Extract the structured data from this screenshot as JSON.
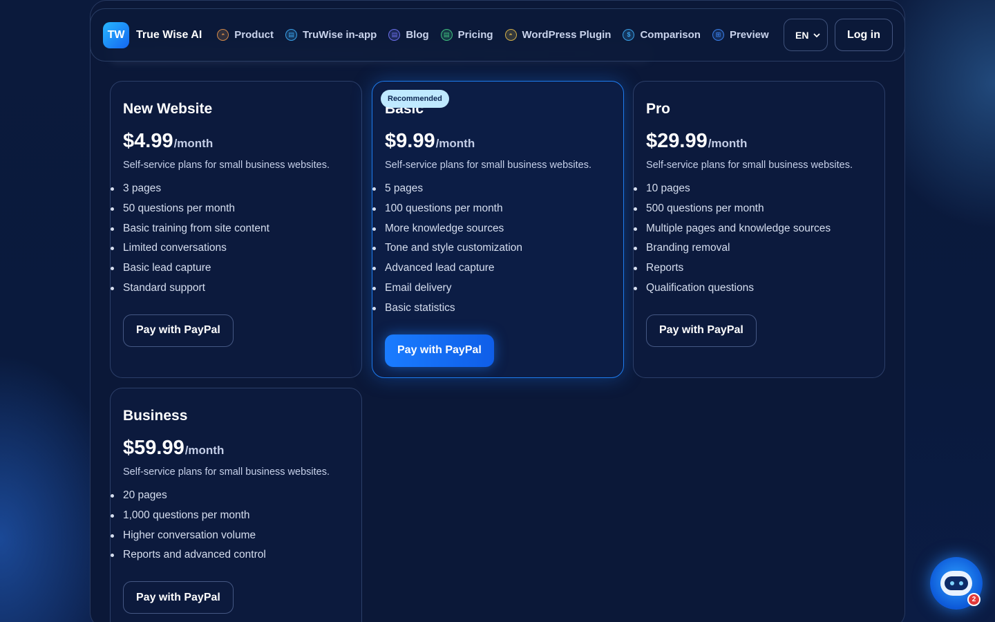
{
  "brand": {
    "logo_text": "TW",
    "name": "True Wise AI"
  },
  "nav": [
    {
      "label": "Product",
      "icon": "robot-icon",
      "color": "#d48a4a",
      "glyph": "◓"
    },
    {
      "label": "TruWise in-app",
      "icon": "chat-icon",
      "color": "#3aa0e8",
      "glyph": "▤"
    },
    {
      "label": "Blog",
      "icon": "document-icon",
      "color": "#6a6ee8",
      "glyph": "▤"
    },
    {
      "label": "Pricing",
      "icon": "card-icon",
      "color": "#3fbf7f",
      "glyph": "▤"
    },
    {
      "label": "WordPress Plugin",
      "icon": "plug-icon",
      "color": "#d4b04a",
      "glyph": "◓"
    },
    {
      "label": "Comparison",
      "icon": "dollar-icon",
      "color": "#3aa0e8",
      "glyph": "$"
    },
    {
      "label": "Preview",
      "icon": "eye-icon",
      "color": "#3a7ee8",
      "glyph": "⊞"
    }
  ],
  "header": {
    "language": "EN",
    "login_label": "Log in"
  },
  "plans": [
    {
      "name": "New Website",
      "price": "$4.99",
      "period": "/month",
      "description": "Self-service plans for small business websites.",
      "features": [
        "3 pages",
        "50 questions per month",
        "Basic training from site content",
        "Limited conversations",
        "Basic lead capture",
        "Standard support"
      ],
      "button": "Pay with PayPal"
    },
    {
      "name": "Basic",
      "badge": "Recommended",
      "price": "$9.99",
      "period": "/month",
      "description": "Self-service plans for small business websites.",
      "features": [
        "5 pages",
        "100 questions per month",
        "More knowledge sources",
        "Tone and style customization",
        "Advanced lead capture",
        "Email delivery",
        "Basic statistics"
      ],
      "button": "Pay with PayPal"
    },
    {
      "name": "Pro",
      "price": "$29.99",
      "period": "/month",
      "description": "Self-service plans for small business websites.",
      "features": [
        "10 pages",
        "500 questions per month",
        "Multiple pages and knowledge sources",
        "Branding removal",
        "Reports",
        "Qualification questions"
      ],
      "button": "Pay with PayPal"
    },
    {
      "name": "Business",
      "price": "$59.99",
      "period": "/month",
      "description": "Self-service plans for small business websites.",
      "features": [
        "20 pages",
        "1,000 questions per month",
        "Higher conversation volume",
        "Reports and advanced control"
      ],
      "button": "Pay with PayPal"
    }
  ],
  "chat_widget": {
    "icon": "chatbot-icon",
    "unread_count": "2"
  },
  "colors": {
    "accent": "#1a7cff",
    "badge_bg": "#bfe9ff",
    "background": "#0a1736"
  }
}
